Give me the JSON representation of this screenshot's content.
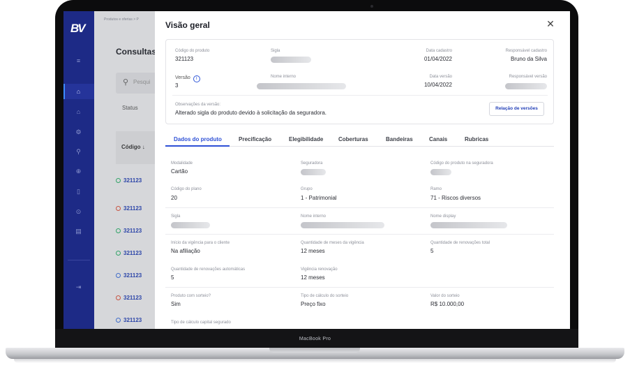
{
  "device": {
    "label": "MacBook Pro"
  },
  "sidebar": {
    "logo": "BV",
    "icons": [
      "menu-icon",
      "home-icon",
      "shield-icon",
      "settings-icon",
      "box-icon",
      "globe-icon",
      "document-icon",
      "alert-icon",
      "file-icon",
      "logout-icon"
    ]
  },
  "background": {
    "breadcrumb": "Produtos e ofertas > P",
    "page_title": "Consultas",
    "search_placeholder": "Pesqui",
    "status_label": "Status",
    "column_header": "Código ↓",
    "rows": [
      {
        "code": "321123",
        "status": "green"
      },
      {
        "code": "321123",
        "status": "red"
      },
      {
        "code": "321123",
        "status": "green"
      },
      {
        "code": "321123",
        "status": "green"
      },
      {
        "code": "321123",
        "status": "blue"
      },
      {
        "code": "321123",
        "status": "red"
      },
      {
        "code": "321123",
        "status": "blue"
      }
    ]
  },
  "modal": {
    "title": "Visão geral",
    "close_glyph": "✕",
    "summary": {
      "product_code_label": "Código do produto",
      "product_code": "321123",
      "sigla_label": "Sigla",
      "created_date_label": "Data cadastro",
      "created_date": "01/04/2022",
      "created_by_label": "Responsável cadastro",
      "created_by": "Bruno da Silva",
      "version_label": "Versão",
      "version": "3",
      "internal_name_label": "Nome interno",
      "version_date_label": "Data versão",
      "version_date": "10/04/2022",
      "version_owner_label": "Responsável versão",
      "notes_label": "Observações da versão:",
      "notes": "Alterado sigla do produto devido à solicitação da seguradora.",
      "versions_button": "Relação de versões"
    },
    "tabs": [
      "Dados do produto",
      "Precificação",
      "Elegibilidade",
      "Coberturas",
      "Bandeiras",
      "Canais",
      "Rubricas"
    ],
    "fields": [
      {
        "label": "Modalidade",
        "value": "Cartão"
      },
      {
        "label": "Seguradora",
        "value": ""
      },
      {
        "label": "Código do produto na seguradora",
        "value": ""
      },
      {
        "label": "Código do plano",
        "value": "20"
      },
      {
        "label": "Grupo",
        "value": "1 - Patrimonial"
      },
      {
        "label": "Ramo",
        "value": "71 - Riscos diversos"
      },
      {
        "label": "Sigla",
        "value": ""
      },
      {
        "label": "Nome interno",
        "value": ""
      },
      {
        "label": "Nome display",
        "value": ""
      },
      {
        "label": "Início da vigência para o cliente",
        "value": "Na afiliação"
      },
      {
        "label": "Quantidade de meses da vigência",
        "value": "12 meses"
      },
      {
        "label": "Quantidade de renovações total",
        "value": "5"
      },
      {
        "label": "Quantidade de renovações automáticas",
        "value": "5"
      },
      {
        "label": "Vigência renovação",
        "value": "12 meses"
      },
      {
        "label": "Produto com sorteio?",
        "value": "Sim"
      },
      {
        "label": "Tipo de cálculo do sorteio",
        "value": "Preço fixo"
      },
      {
        "label": "Valor do sorteio",
        "value": "R$ 10.000,00"
      },
      {
        "label": "Tipo de cálculo capital segurado",
        "value": ""
      }
    ]
  }
}
